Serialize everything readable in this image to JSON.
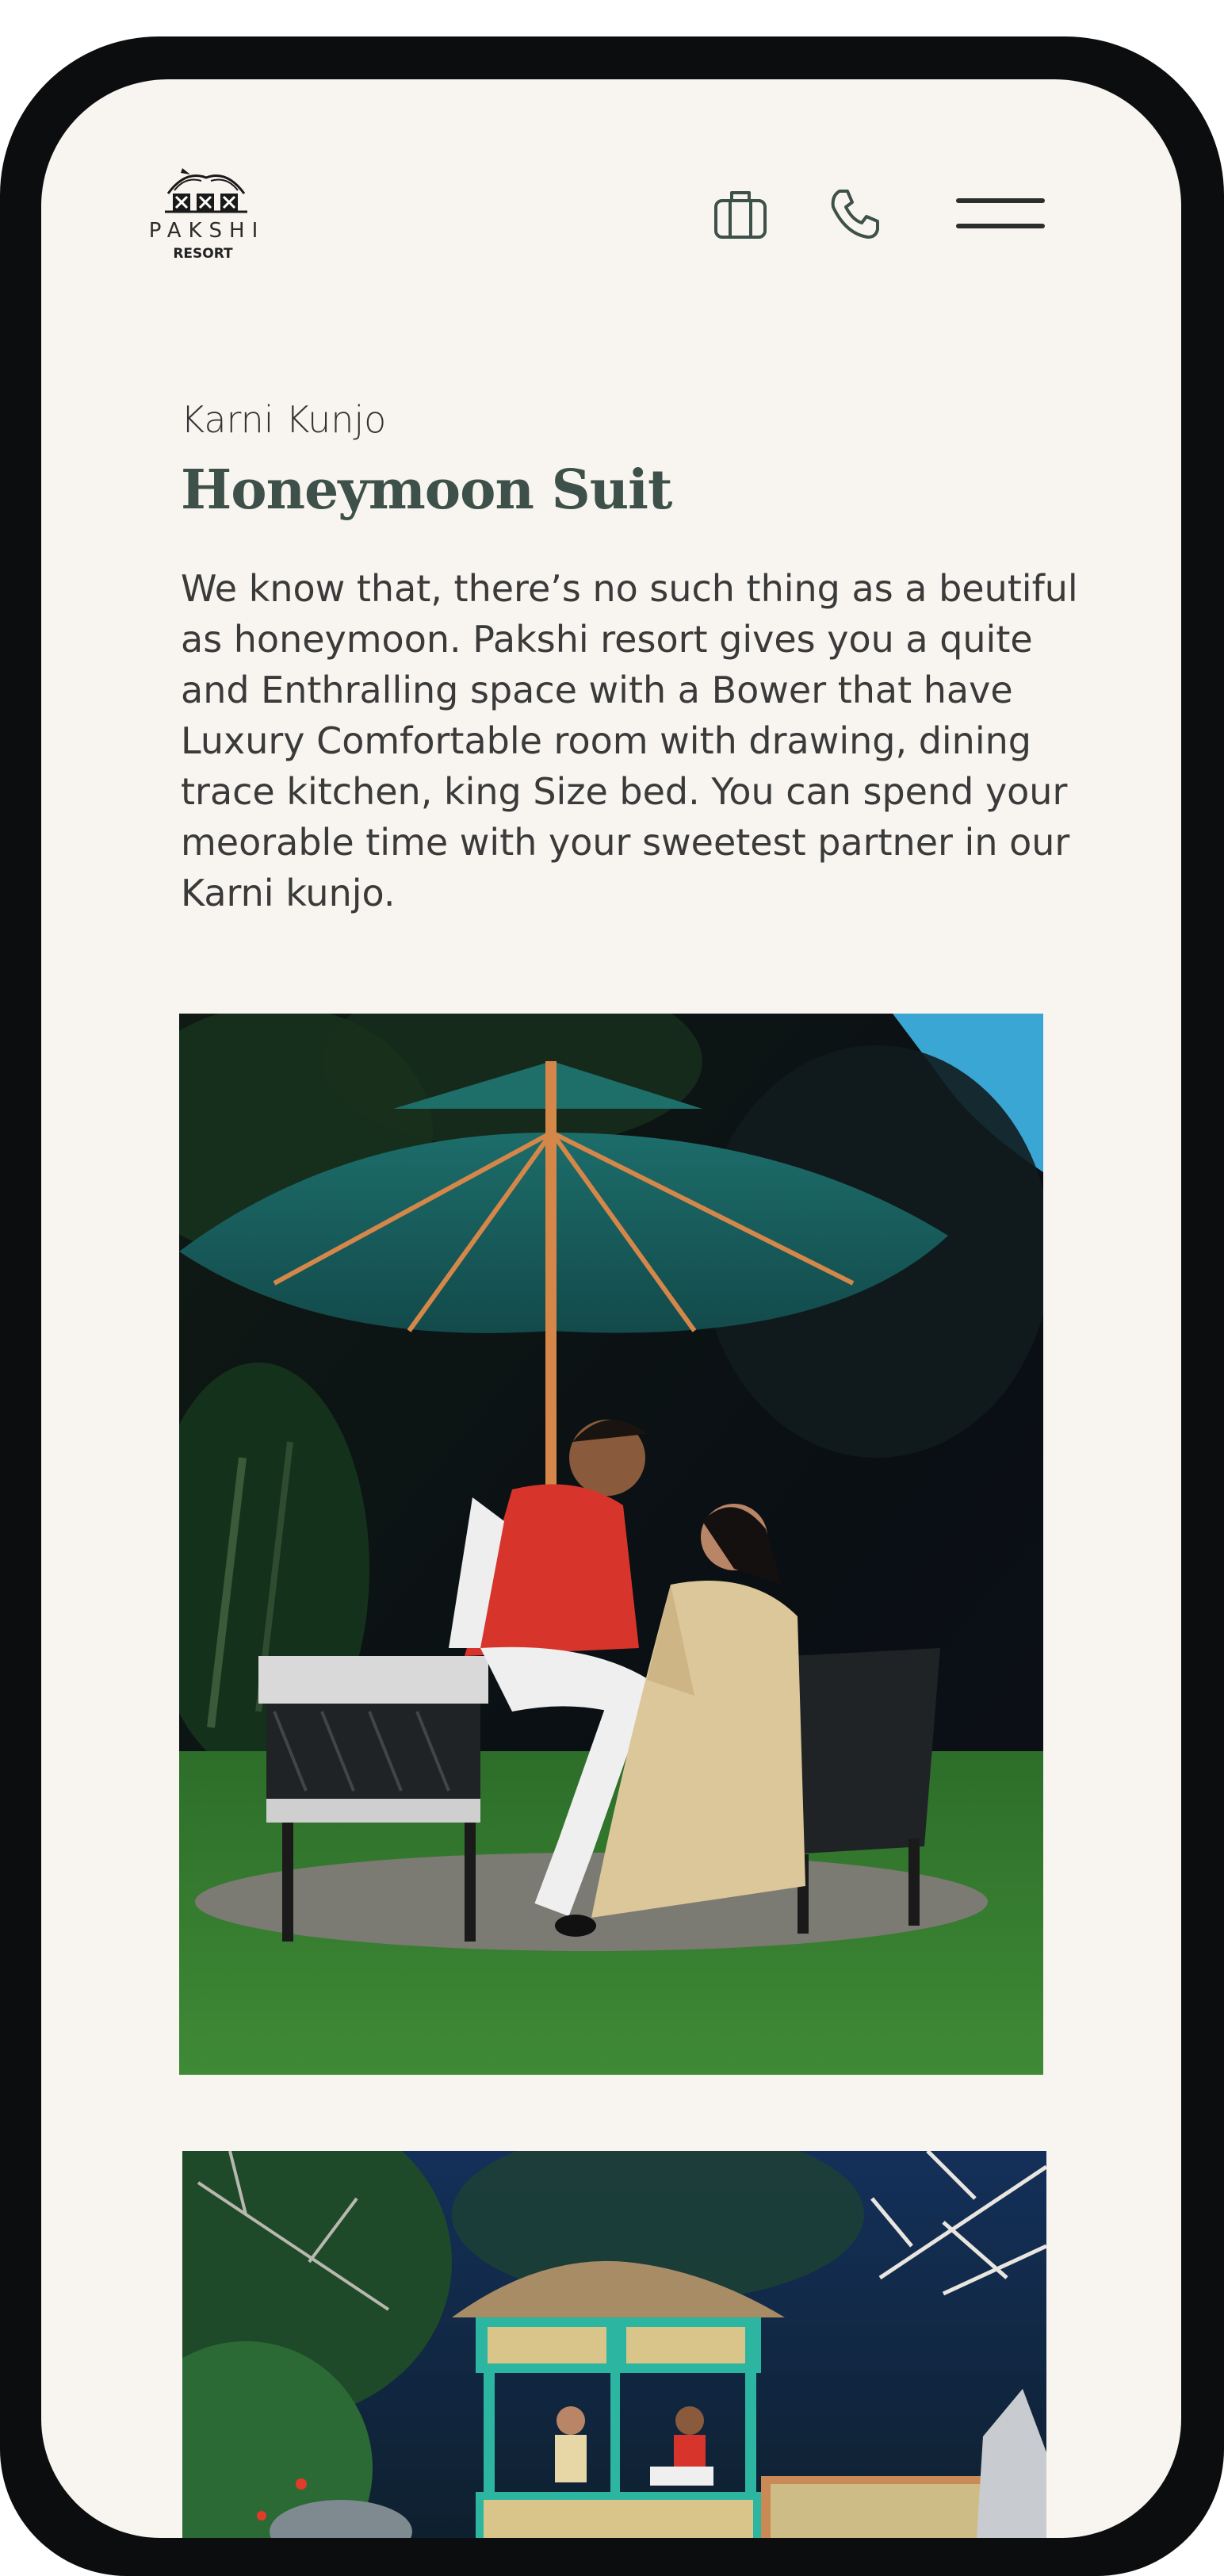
{
  "header": {
    "logo_word": "PAKSHI",
    "logo_sub": "RESORT",
    "icons": [
      "suitcase-icon",
      "phone-icon",
      "menu-icon"
    ]
  },
  "content": {
    "subtitle": "Karni Kunjo",
    "title": "Honeymoon Suit",
    "description": "We know that, there’s no such thing as a beutiful as honeymoon. Pakshi resort gives you a quite and Enthralling space with a Bower that have Luxury Comfortable room with drawing, dining trace kitchen, king Size bed. You can spend your meorable time with your sweetest partner in our Karni kunjo."
  },
  "colors": {
    "title": "#3d5049",
    "background": "#f8f5f0",
    "frame": "#0c0d0e",
    "icon_stroke": "#3d5049"
  }
}
